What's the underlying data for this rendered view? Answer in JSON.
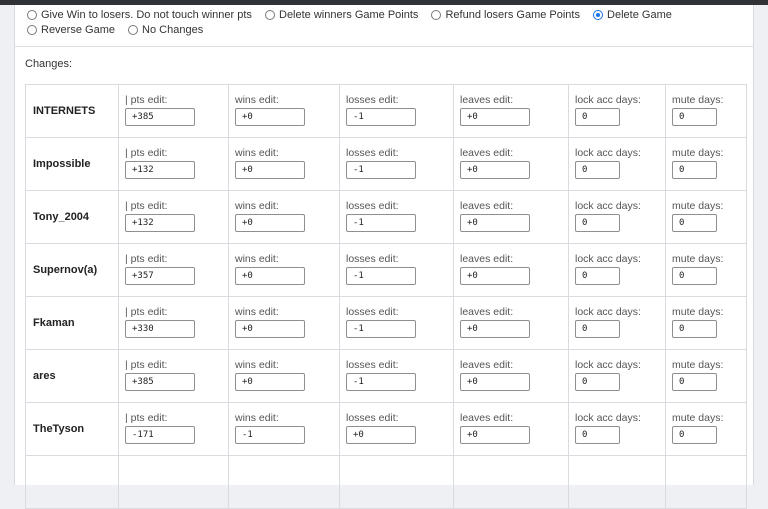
{
  "options": [
    {
      "label": "Give Win to losers. Do not touch winner pts",
      "checked": false
    },
    {
      "label": "Delete winners Game Points",
      "checked": false
    },
    {
      "label": "Refund losers Game Points",
      "checked": false
    },
    {
      "label": "Delete Game",
      "checked": true
    },
    {
      "label": "Reverse Game",
      "checked": false
    },
    {
      "label": "No Changes",
      "checked": false
    }
  ],
  "changes_label": "Changes:",
  "field_labels": {
    "pts": "| pts edit:",
    "wins": "wins edit:",
    "losses": "losses edit:",
    "leaves": "leaves edit:",
    "lock": "lock acc days:",
    "mute": "mute days:"
  },
  "rows": [
    {
      "name": "INTERNETS",
      "pts": "+385",
      "wins": "+0",
      "losses": "-1",
      "leaves": "+0",
      "lock": "0",
      "mute": "0"
    },
    {
      "name": "Impossible",
      "pts": "+132",
      "wins": "+0",
      "losses": "-1",
      "leaves": "+0",
      "lock": "0",
      "mute": "0"
    },
    {
      "name": "Tony_2004",
      "pts": "+132",
      "wins": "+0",
      "losses": "-1",
      "leaves": "+0",
      "lock": "0",
      "mute": "0"
    },
    {
      "name": "Supernov(a)",
      "pts": "+357",
      "wins": "+0",
      "losses": "-1",
      "leaves": "+0",
      "lock": "0",
      "mute": "0"
    },
    {
      "name": "Fkaman",
      "pts": "+330",
      "wins": "+0",
      "losses": "-1",
      "leaves": "+0",
      "lock": "0",
      "mute": "0"
    },
    {
      "name": "ares",
      "pts": "+385",
      "wins": "+0",
      "losses": "-1",
      "leaves": "+0",
      "lock": "0",
      "mute": "0"
    },
    {
      "name": "TheTyson",
      "pts": "-171",
      "wins": "-1",
      "losses": "+0",
      "leaves": "+0",
      "lock": "0",
      "mute": "0"
    },
    {
      "name": "",
      "pts": "",
      "wins": "",
      "losses": "",
      "leaves": "",
      "lock": "",
      "mute": ""
    }
  ]
}
